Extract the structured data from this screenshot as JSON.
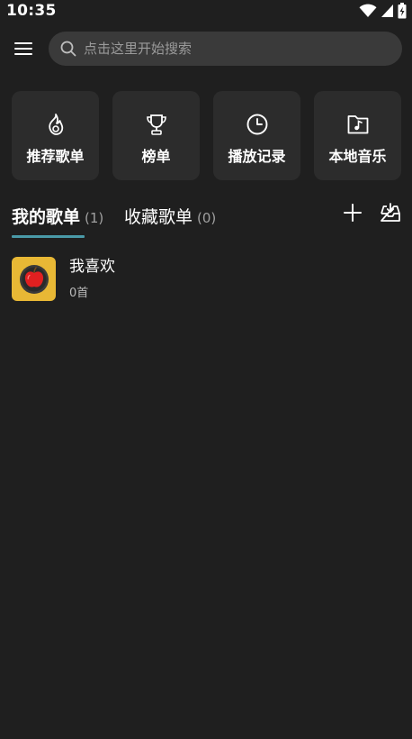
{
  "status_bar": {
    "time": "10:35"
  },
  "header": {
    "search_placeholder": "点击这里开始搜索"
  },
  "shortcuts": [
    {
      "label": "推荐歌单",
      "icon": "fire-icon"
    },
    {
      "label": "榜单",
      "icon": "trophy-icon"
    },
    {
      "label": "播放记录",
      "icon": "clock-icon"
    },
    {
      "label": "本地音乐",
      "icon": "music-folder-icon"
    }
  ],
  "tabs": [
    {
      "title": "我的歌单",
      "count": "(1)"
    },
    {
      "title": "收藏歌单",
      "count": "(0)"
    }
  ],
  "playlists": [
    {
      "title": "我喜欢",
      "subtitle": "0首"
    }
  ],
  "colors": {
    "background": "#1f1f1f",
    "card": "#2c2c2c",
    "search": "#3a3a3a",
    "accent": "#4a9aa8",
    "cover": "#e8b835"
  }
}
